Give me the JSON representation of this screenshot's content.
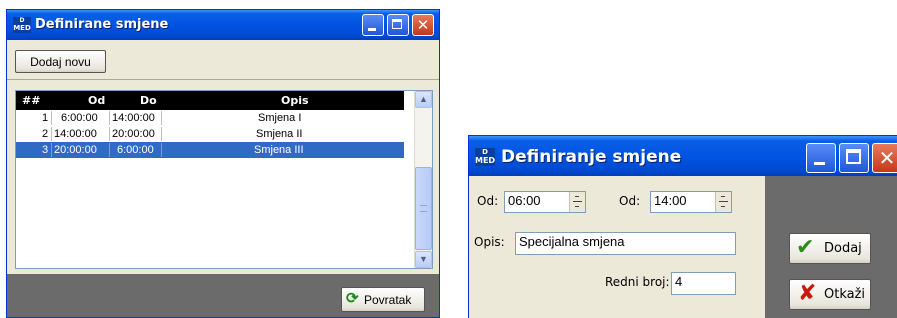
{
  "window1": {
    "title": "Definirane smjene",
    "logo_text": "MED",
    "add_button_label": "Dodaj novu",
    "grid": {
      "columns": [
        "##",
        "Od",
        "Do",
        "Opis"
      ],
      "rows": [
        {
          "num": "1",
          "od": "6:00:00",
          "do": "14:00:00",
          "opis": "Smjena I"
        },
        {
          "num": "2",
          "od": "14:00:00",
          "do": "20:00:00",
          "opis": "Smjena II"
        },
        {
          "num": "3",
          "od": "20:00:00",
          "do": "6:00:00",
          "opis": "Smjena III"
        }
      ],
      "selected_row": 3
    },
    "back_button_label": "Povratak"
  },
  "window2": {
    "title": "Definiranje smjene",
    "logo_text": "MED",
    "from_label": "Od:",
    "from_value": "06:00",
    "to_label": "Od:",
    "to_value": "14:00",
    "desc_label": "Opis:",
    "desc_value": "Specijalna smjena",
    "order_label": "Redni broj:",
    "order_value": "4",
    "add_button_label": "Dodaj",
    "cancel_button_label": "Otkaži"
  },
  "colors": {
    "titlebar": "#0054e3",
    "selection": "#316ac5",
    "grid_header": "#000000",
    "window_body": "#ece9d8",
    "status_strip": "#6b6b6b"
  }
}
